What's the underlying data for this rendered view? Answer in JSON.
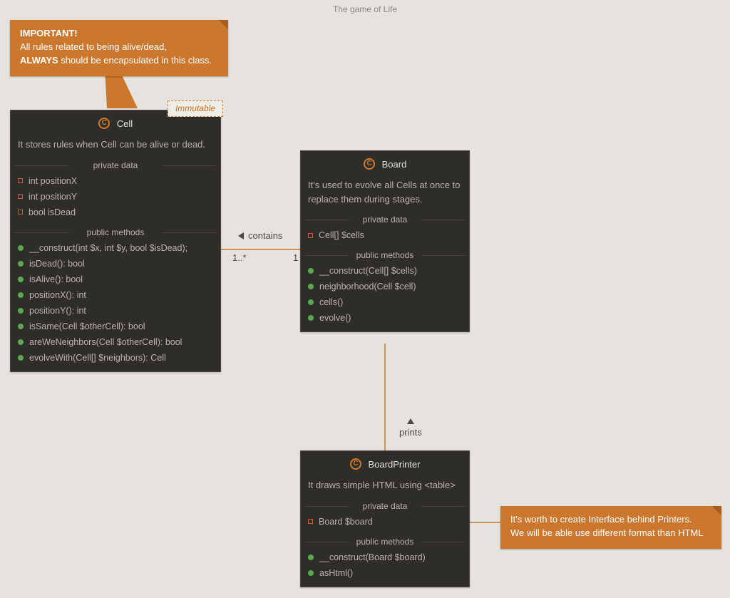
{
  "title": "The game of Life",
  "notes": {
    "cellNote": {
      "line1_strong": "IMPORTANT!",
      "line2": "All rules related to being alive/dead,",
      "line3_strong": "ALWAYS",
      "line3_rest": " should be encapsulated in this class."
    },
    "printerNote": {
      "line1": "It's worth to create Interface behind Printers.",
      "line2": "We will be able use different format than HTML"
    }
  },
  "assoc": {
    "contains": "contains",
    "prints": "prints",
    "mult_many": "1..*",
    "mult_one": "1"
  },
  "classes": {
    "cell": {
      "name": "Cell",
      "immutable": "Immutable",
      "desc": "It stores rules when Cell can be alive or dead.",
      "privateLabel": "private data",
      "publicLabel": "public methods",
      "fields": [
        "int positionX",
        "int positionY",
        "bool isDead"
      ],
      "methods": [
        "__construct(int $x, int $y, bool $isDead);",
        "isDead(): bool",
        "isAlive(): bool",
        "positionX(): int",
        "positionY(): int",
        "isSame(Cell $otherCell): bool",
        "areWeNeighbors(Cell $otherCell): bool",
        "evolveWith(Cell[] $neighbors): Cell"
      ]
    },
    "board": {
      "name": "Board",
      "desc": "It's used to evolve all Cells at once to replace them during stages.",
      "privateLabel": "private data",
      "publicLabel": "public methods",
      "fields": [
        "Cell[] $cells"
      ],
      "methods": [
        "__construct(Cell[] $cells)",
        "neighborhood(Cell $cell)",
        "cells()",
        "evolve()"
      ]
    },
    "printer": {
      "name": "BoardPrinter",
      "desc": "It draws simple HTML using <table>",
      "privateLabel": "private data",
      "publicLabel": "public methods",
      "fields": [
        "Board $board"
      ],
      "methods": [
        "__construct(Board $board)",
        "asHtml()"
      ]
    }
  }
}
